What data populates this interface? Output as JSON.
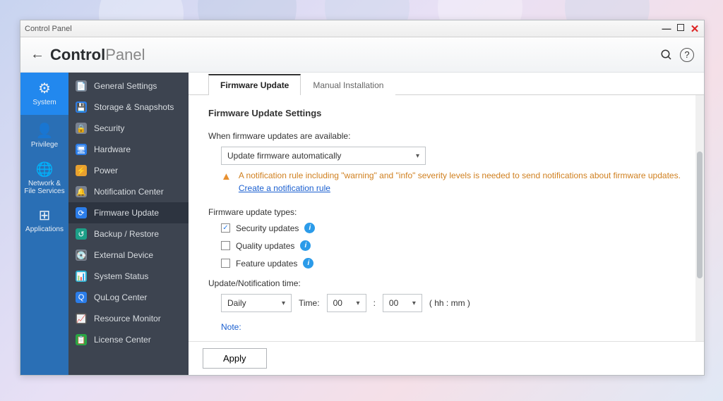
{
  "window": {
    "title": "Control Panel"
  },
  "header": {
    "title_bold": "Control",
    "title_light": "Panel"
  },
  "leftnav": [
    {
      "icon": "⚙",
      "label": "System",
      "active": true
    },
    {
      "icon": "👤",
      "label": "Privilege"
    },
    {
      "icon": "🌐",
      "label": "Network & File Services"
    },
    {
      "icon": "⊞",
      "label": "Applications"
    }
  ],
  "sidebar": [
    {
      "icon": "📄",
      "cls": "ic-gray",
      "label": "General Settings"
    },
    {
      "icon": "💾",
      "cls": "ic-blue",
      "label": "Storage & Snapshots"
    },
    {
      "icon": "🔒",
      "cls": "ic-gray",
      "label": "Security"
    },
    {
      "icon": "🖥",
      "cls": "ic-blue",
      "label": "Hardware"
    },
    {
      "icon": "⚡",
      "cls": "ic-yellow",
      "label": "Power"
    },
    {
      "icon": "🔔",
      "cls": "ic-gray",
      "label": "Notification Center"
    },
    {
      "icon": "⟳",
      "cls": "ic-blue",
      "label": "Firmware Update",
      "active": true
    },
    {
      "icon": "↺",
      "cls": "ic-teal",
      "label": "Backup / Restore"
    },
    {
      "icon": "💽",
      "cls": "ic-gray",
      "label": "External Device"
    },
    {
      "icon": "📊",
      "cls": "ic-cyan",
      "label": "System Status"
    },
    {
      "icon": "Q",
      "cls": "ic-blue",
      "label": "QuLog Center"
    },
    {
      "icon": "📈",
      "cls": "ic-dark",
      "label": "Resource Monitor"
    },
    {
      "icon": "📋",
      "cls": "ic-green",
      "label": "License Center"
    }
  ],
  "tabs": [
    {
      "label": "Firmware Update",
      "active": true
    },
    {
      "label": "Manual Installation"
    }
  ],
  "settings": {
    "section_title": "Firmware Update Settings",
    "when_label": "When firmware updates are available:",
    "when_select": "Update firmware automatically",
    "warning_text": "A notification rule including \"warning\" and \"info\" severity levels is needed to send notifications about firmware updates. ",
    "warning_link": "Create a notification rule",
    "types_label": "Firmware update types:",
    "cb_security": "Security updates",
    "cb_quality": "Quality updates",
    "cb_feature": "Feature updates",
    "time_label": "Update/Notification time:",
    "freq": "Daily",
    "time_word": "Time:",
    "hh": "00",
    "mm": "00",
    "hhmm_hint": "( hh : mm )",
    "note_label": "Note:",
    "apply": "Apply"
  }
}
